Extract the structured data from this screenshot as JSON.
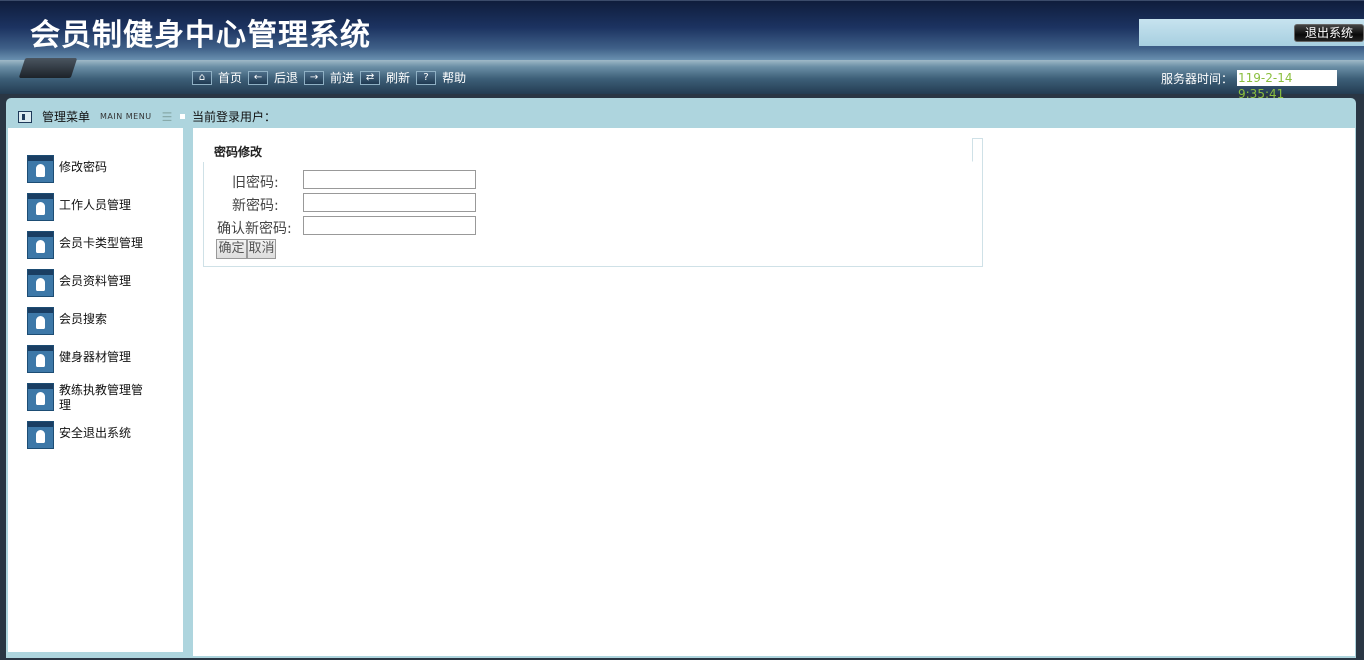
{
  "header": {
    "title": "会员制健身中心管理系统",
    "logout_label": "退出系统"
  },
  "nav": {
    "items": [
      {
        "label": "首页",
        "icon": "home-icon"
      },
      {
        "label": "后退",
        "icon": "back-arrow-icon"
      },
      {
        "label": "前进",
        "icon": "forward-arrow-icon"
      },
      {
        "label": "刷新",
        "icon": "refresh-icon"
      },
      {
        "label": "帮助",
        "icon": "help-icon"
      }
    ],
    "server_time_label": "服务器时间：",
    "server_time_value": "119-2-14 9:35:41"
  },
  "menu_bar": {
    "title": "管理菜单",
    "subtitle": "MAIN MENU",
    "current_user_label": "当前登录用户："
  },
  "sidebar": {
    "items": [
      {
        "label": "修改密码"
      },
      {
        "label": "工作人员管理"
      },
      {
        "label": "会员卡类型管理"
      },
      {
        "label": "会员资料管理"
      },
      {
        "label": "会员搜索"
      },
      {
        "label": "健身器材管理"
      },
      {
        "label": "教练执教管理管理"
      },
      {
        "label": "安全退出系统"
      }
    ]
  },
  "form": {
    "title": "密码修改",
    "old_password_label": "旧密码:",
    "new_password_label": "新密码:",
    "confirm_password_label": "确认新密码:",
    "old_password_value": "",
    "new_password_value": "",
    "confirm_password_value": "",
    "confirm_button": "确定",
    "cancel_button": "取消"
  },
  "colors": {
    "header_dark": "#0f1d3c",
    "frame_bg": "#aed5de",
    "server_time_text": "#8bbf3f"
  }
}
